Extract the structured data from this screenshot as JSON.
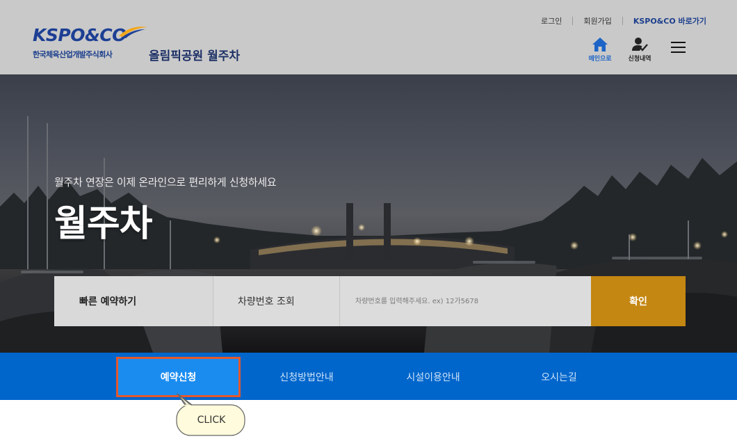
{
  "header": {
    "top_links": {
      "login": "로그인",
      "signup": "회원가입",
      "kspo": "KSPO&CO 바로가기"
    },
    "logo": {
      "text": "KSPO&CO",
      "subtitle": "한국체육산업개발주식회사"
    },
    "site_title": "올림픽공원 월주차",
    "nav": {
      "home_label": "메인으로",
      "history_label": "신청내역"
    }
  },
  "hero": {
    "subtitle": "월주차 연장은 이제 온라인으로 편리하게 신청하세요",
    "title": "월주차"
  },
  "quick_reserve": {
    "title": "빠른 예약하기",
    "field_label": "차량번호 조회",
    "input_placeholder": "차량번호를 입력해주세요. ex) 12가5678",
    "input_value": "",
    "confirm_label": "확인"
  },
  "tabs": [
    {
      "label": "예약신청",
      "active": true
    },
    {
      "label": "신청방법안내",
      "active": false
    },
    {
      "label": "시설이용안내",
      "active": false
    },
    {
      "label": "오시는길",
      "active": false
    }
  ],
  "callout": {
    "text": "CLICK"
  },
  "colors": {
    "header_bg": "#c9c9c9",
    "brand_blue": "#1d3f94",
    "tab_bar": "#0066cc",
    "tab_active": "#1a8cf0",
    "highlight": "#e4572e",
    "confirm": "#c48712",
    "callout_bg": "#fffbdc"
  }
}
